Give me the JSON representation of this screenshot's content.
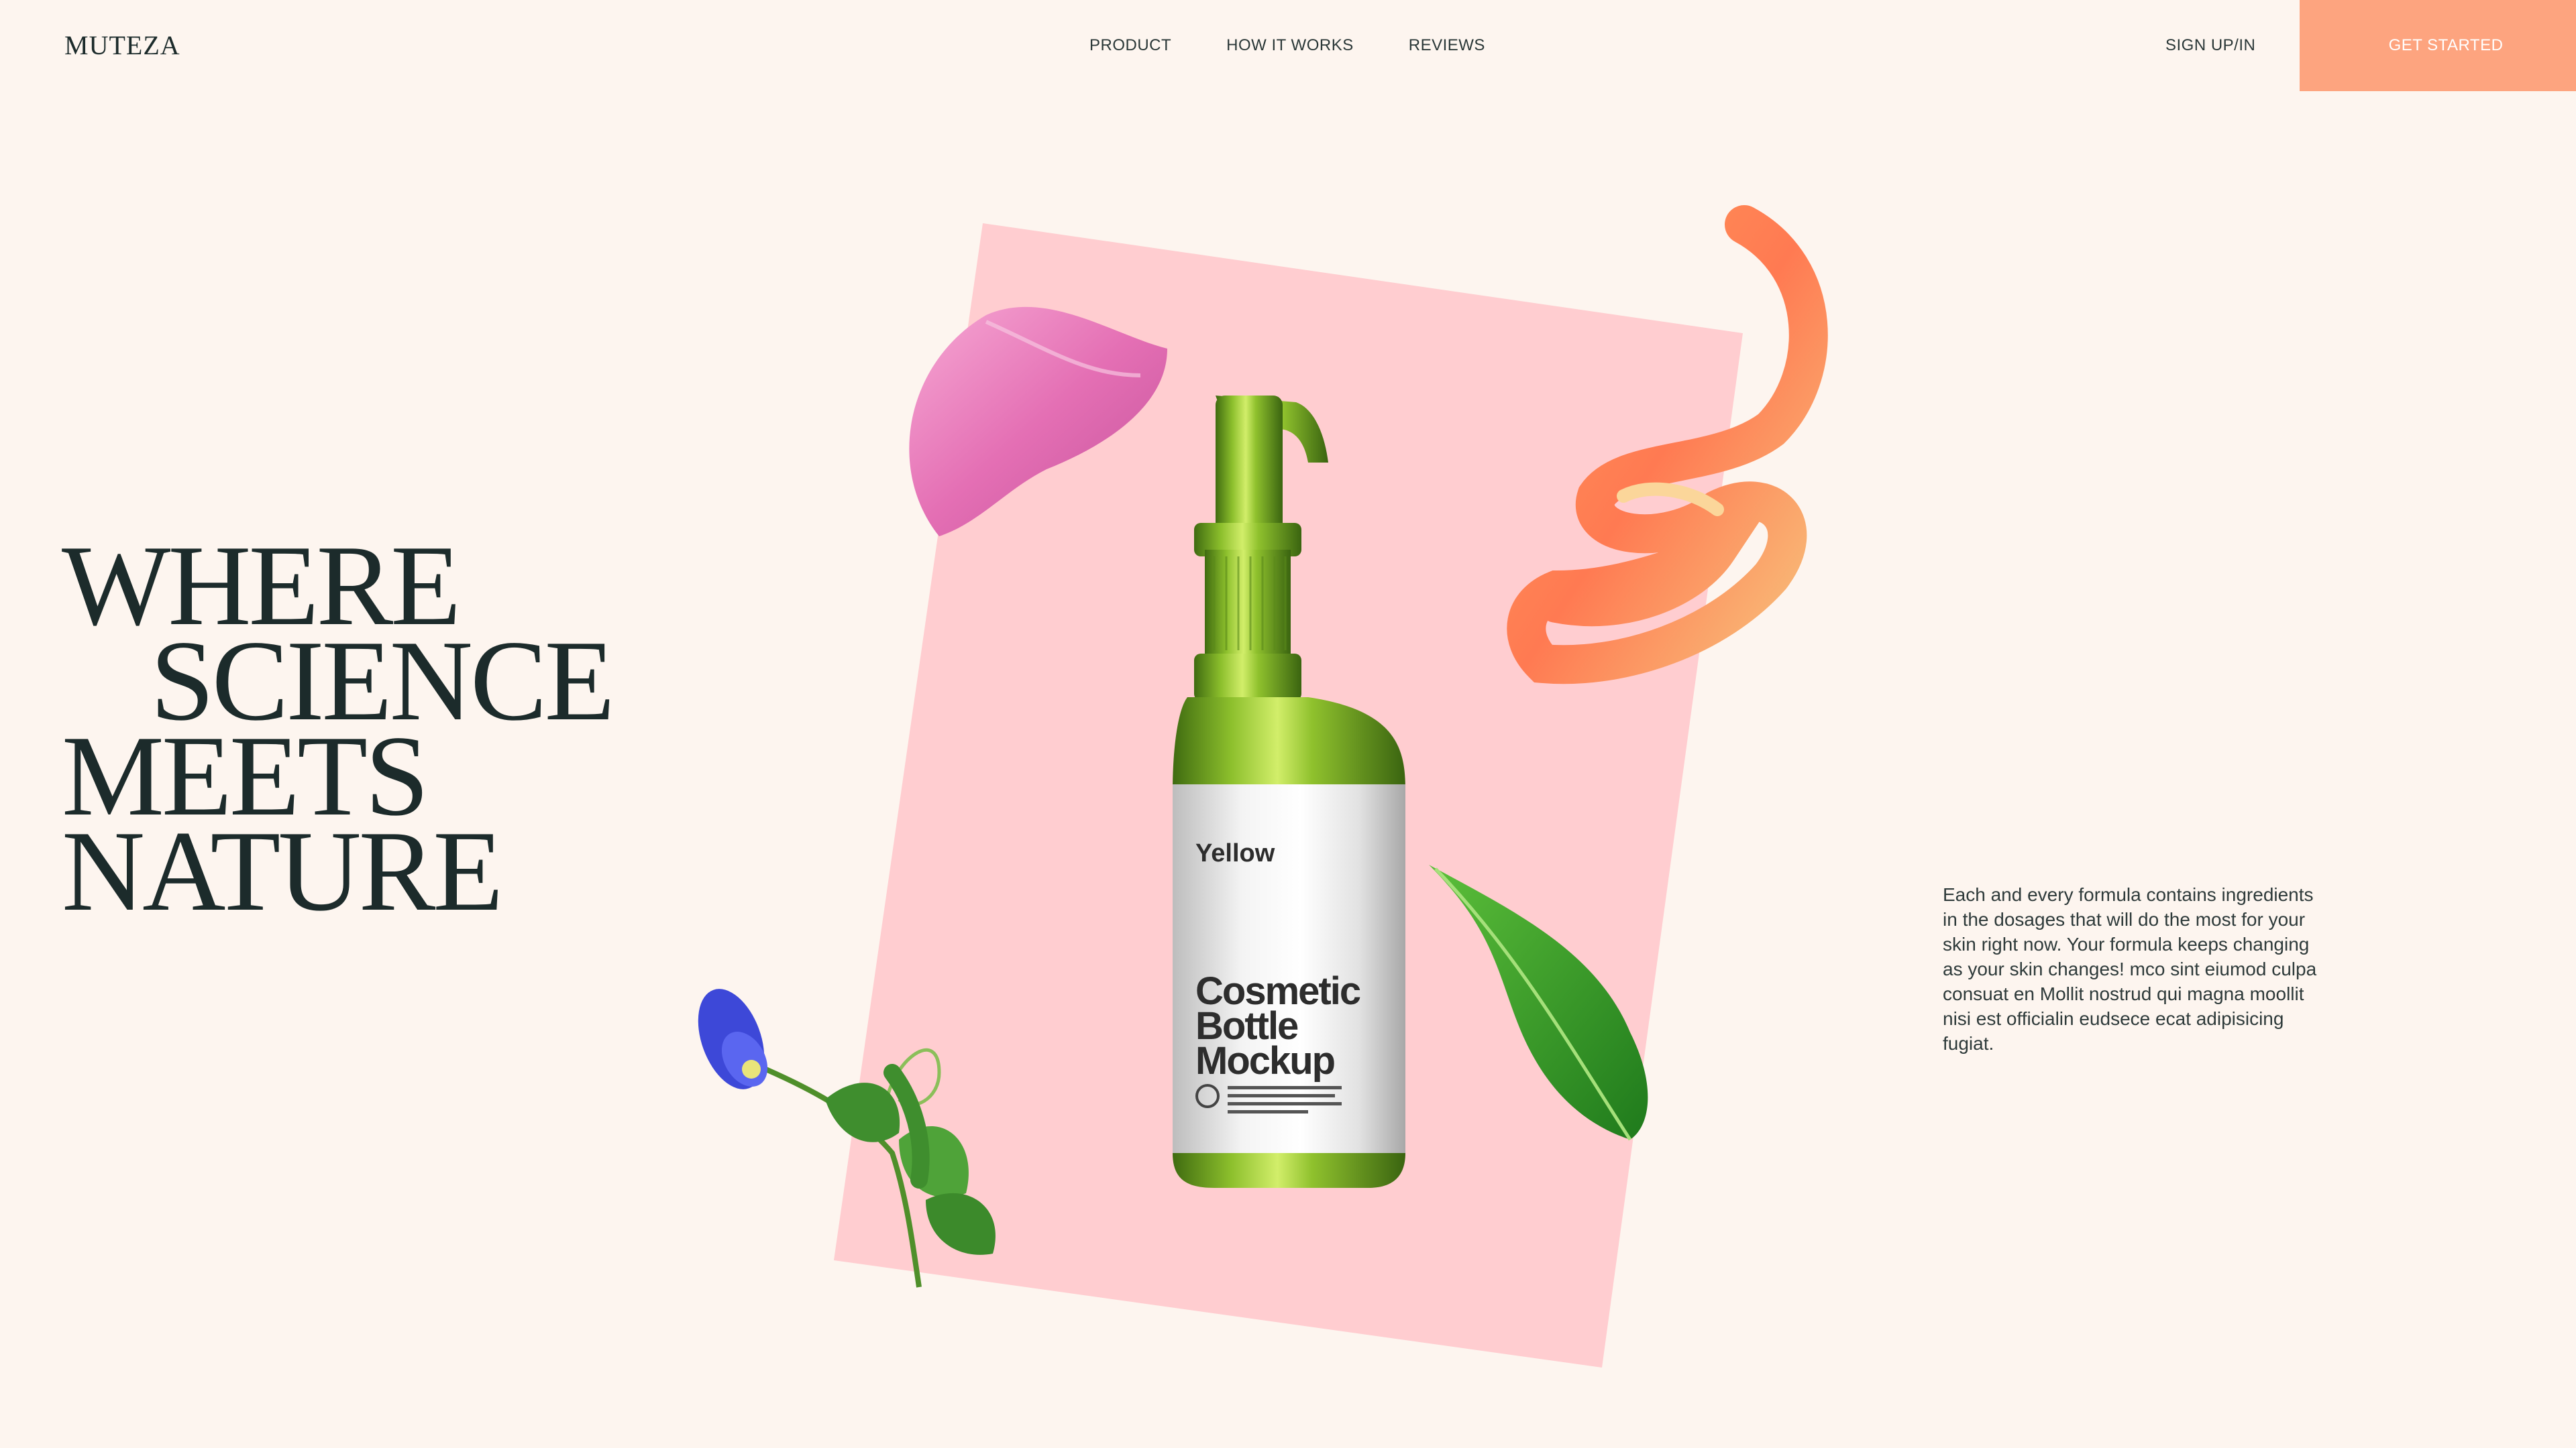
{
  "brand": {
    "name": "MUTEZA"
  },
  "nav": {
    "items": [
      {
        "label": "PRODUCT"
      },
      {
        "label": "HOW IT WORKS"
      },
      {
        "label": "REVIEWS"
      }
    ],
    "signin_label": "SIGN UP/IN",
    "cta_label": "GET STARTED"
  },
  "hero": {
    "headline_lines": [
      "WHERE",
      "SCIENCE",
      "MEETS",
      "NATURE"
    ],
    "description": "Each and every formula contains ingredients in the dosages that will do the most for your skin right now. Your formula keeps changing as your skin changes! mco sint eiumod culpa consuat en Mollit nostrud qui magna moollit nisi est officialin eudsece ecat adipisicing fugiat.",
    "product_label": {
      "brand": "Yellow",
      "title_lines": [
        "Cosmetic",
        "Bottle",
        "Mockup"
      ]
    }
  },
  "colors": {
    "background": "#fdf5ef",
    "accent": "#fda47f",
    "pink_panel": "#ffcdd0",
    "text_dark": "#1c2b2b"
  },
  "icons": [
    "rose-petal-icon",
    "orange-peel-icon",
    "leaf-icon",
    "blue-flower-icon"
  ]
}
